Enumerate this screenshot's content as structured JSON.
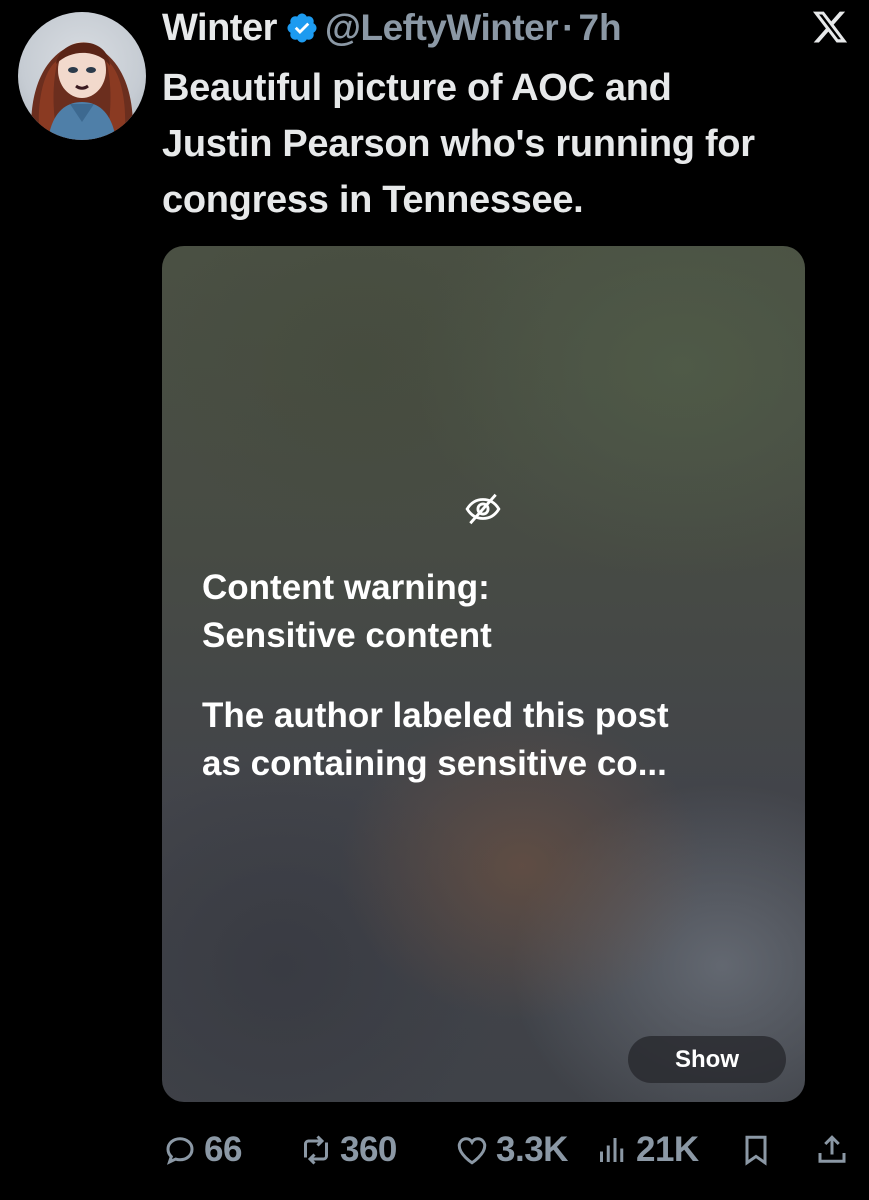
{
  "author": {
    "name": "Winter",
    "handle": "@LeftyWinter",
    "separator": "·",
    "time": "7h"
  },
  "tweet": {
    "text_lines": [
      "Beautiful picture of AOC and",
      "Justin Pearson who's running for",
      "congress in Tennessee."
    ]
  },
  "media": {
    "warning_title_lines": [
      "Content warning:",
      "Sensitive content"
    ],
    "warning_desc_lines": [
      "The author labeled this post",
      "as containing sensitive co..."
    ],
    "show_label": "Show"
  },
  "actions": {
    "replies": "66",
    "reposts": "360",
    "likes": "3.3K",
    "views": "21K"
  },
  "colors": {
    "background": "#000000",
    "text": "#e7e9ea",
    "secondary": "#8b98a5",
    "verified": "#1d9bf0"
  },
  "icons": [
    "verified-badge-icon",
    "x-logo-icon",
    "eye-off-icon",
    "reply-icon",
    "repost-icon",
    "like-icon",
    "views-icon",
    "bookmark-icon",
    "share-icon"
  ]
}
